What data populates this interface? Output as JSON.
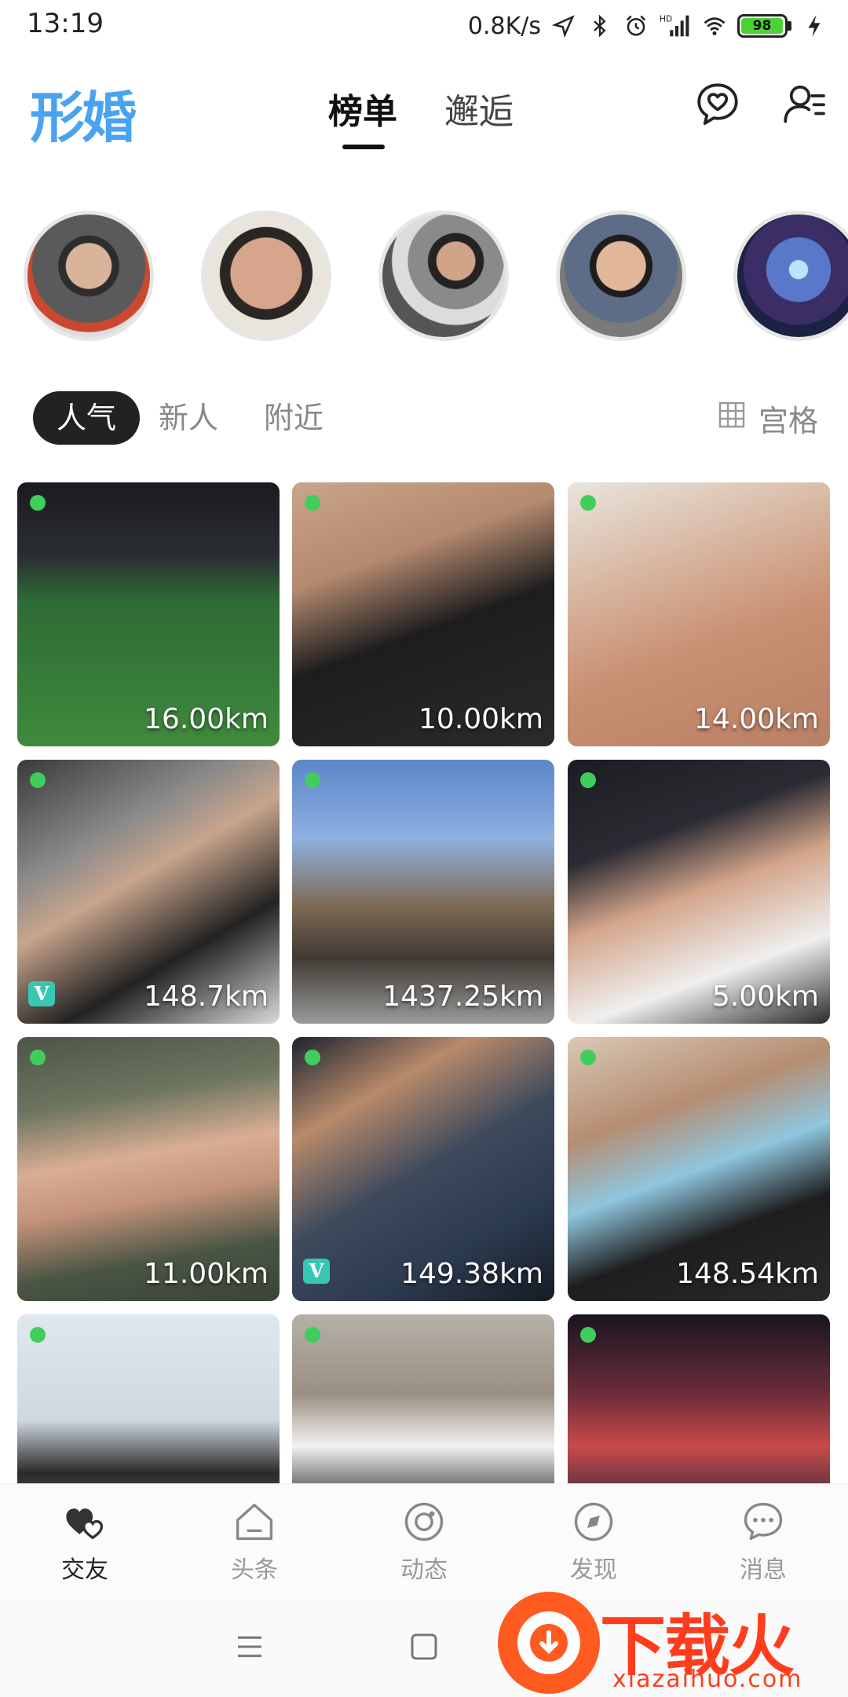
{
  "status_bar": {
    "time": "13:19",
    "net_speed": "0.8K/s",
    "network_label": "HD",
    "battery": "98",
    "battery_level": 0.98,
    "icons": [
      "location-arrow-icon",
      "bluetooth-icon",
      "alarm-icon",
      "signal-icon",
      "wifi-icon",
      "battery-icon",
      "charging-bolt-icon"
    ]
  },
  "header": {
    "logo": "形婚",
    "tabs": [
      {
        "label": "榜单",
        "active": true
      },
      {
        "label": "邂逅",
        "active": false
      }
    ],
    "icons": [
      "heart-chat-icon",
      "user-list-icon"
    ]
  },
  "filters": {
    "items": [
      {
        "label": "人气",
        "active": true
      },
      {
        "label": "新人",
        "active": false
      },
      {
        "label": "附近",
        "active": false
      }
    ],
    "view_toggle": "宫格",
    "view_icon": "grid-icon"
  },
  "stories": [
    {
      "name": "story-avatar-1"
    },
    {
      "name": "story-avatar-2"
    },
    {
      "name": "story-avatar-3"
    },
    {
      "name": "story-avatar-4"
    },
    {
      "name": "story-avatar-5"
    }
  ],
  "cards": [
    {
      "distance": "16.00km",
      "online": true,
      "verified": false
    },
    {
      "distance": "10.00km",
      "online": true,
      "verified": false
    },
    {
      "distance": "14.00km",
      "online": true,
      "verified": false
    },
    {
      "distance": "148.7km",
      "online": true,
      "verified": true
    },
    {
      "distance": "1437.25km",
      "online": true,
      "verified": false
    },
    {
      "distance": "5.00km",
      "online": true,
      "verified": false
    },
    {
      "distance": "11.00km",
      "online": true,
      "verified": false
    },
    {
      "distance": "149.38km",
      "online": true,
      "verified": true
    },
    {
      "distance": "148.54km",
      "online": true,
      "verified": false
    },
    {
      "distance": "",
      "online": true,
      "verified": false
    },
    {
      "distance": "",
      "online": true,
      "verified": false
    },
    {
      "distance": "",
      "online": true,
      "verified": false
    }
  ],
  "verified_badge": "V",
  "bottom_nav": [
    {
      "label": "交友",
      "icon": "hearts-icon",
      "active": true
    },
    {
      "label": "头条",
      "icon": "home-icon",
      "active": false
    },
    {
      "label": "动态",
      "icon": "moments-icon",
      "active": false
    },
    {
      "label": "发现",
      "icon": "discover-icon",
      "active": false
    },
    {
      "label": "消息",
      "icon": "message-icon",
      "active": false
    }
  ],
  "system_nav": [
    "menu-icon",
    "home-square-icon"
  ],
  "watermark": {
    "title": "下载火",
    "subtitle": "xiazaihuo.com"
  },
  "colors": {
    "accent": "#4aa3f0",
    "online": "#3fce5c",
    "verified": "#37c7b5",
    "watermark": "#ff3d1d"
  }
}
